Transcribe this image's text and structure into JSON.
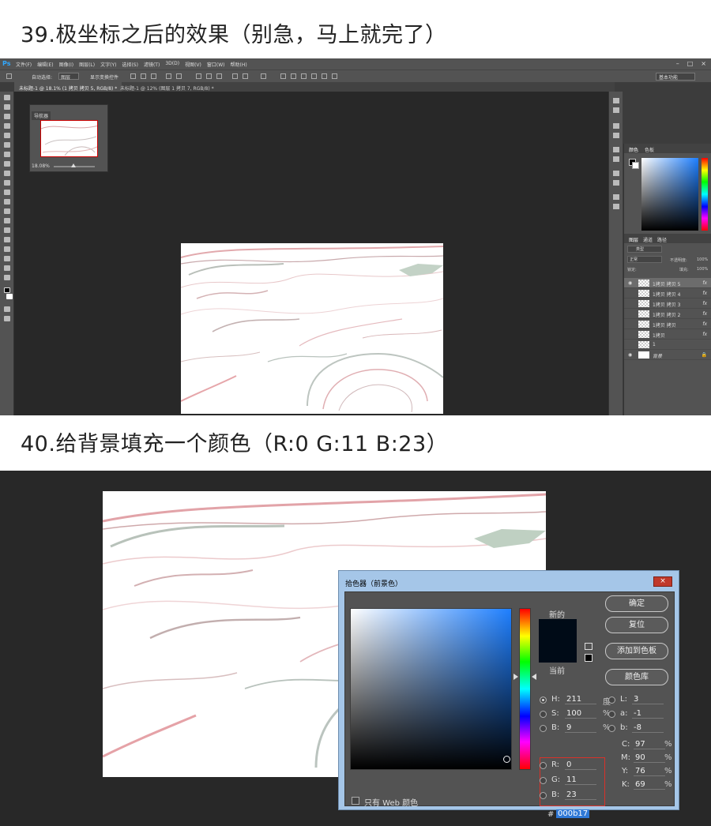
{
  "step39": {
    "title": "39.极坐标之后的效果（别急，马上就完了）"
  },
  "step40": {
    "title": "40.给背景填充一个颜色（R:0  G:11  B:23）"
  },
  "ps": {
    "logo": "Ps",
    "menus": [
      "文件(F)",
      "编辑(E)",
      "图像(I)",
      "图层(L)",
      "文字(Y)",
      "选择(S)",
      "滤镜(T)",
      "3D(D)",
      "视图(V)",
      "窗口(W)",
      "帮助(H)"
    ],
    "options": {
      "auto_select": "自动选择:",
      "auto_select_value": "图层",
      "show_transform": "显示变换控件"
    },
    "workspace": "基本功能",
    "tabs": [
      "未标题-1 @ 18.1% (1 拷贝 拷贝 5, RGB/8) *",
      "未标题-1 @ 12% (图层 1 拷贝 7, RGB/8) *"
    ],
    "navigator": {
      "title": "导航器",
      "zoom": "18.08%"
    },
    "color_panel": {
      "tabs": [
        "颜色",
        "色板"
      ]
    },
    "layers_panel": {
      "tabs": [
        "图层",
        "通道",
        "路径"
      ],
      "filter": "类型",
      "blend": "正常",
      "opacity_label": "不透明度:",
      "opacity": "100%",
      "lock_label": "锁定:",
      "fill_label": "填充:",
      "fill": "100%",
      "layers": [
        {
          "name": "1拷贝 拷贝 5",
          "fx": "fx"
        },
        {
          "name": "1拷贝 拷贝 4",
          "fx": "fx"
        },
        {
          "name": "1拷贝 拷贝 3",
          "fx": "fx"
        },
        {
          "name": "1拷贝 拷贝 2",
          "fx": "fx"
        },
        {
          "name": "1拷贝 拷贝",
          "fx": "fx"
        },
        {
          "name": "1拷贝",
          "fx": "fx"
        },
        {
          "name": "1",
          "fx": ""
        },
        {
          "name": "背景",
          "fx": ""
        }
      ]
    }
  },
  "picker": {
    "title": "拾色器（前景色）",
    "close": "×",
    "new_label": "新的",
    "current_label": "当前",
    "new_color": "#000b17",
    "current_color": "#000b17",
    "buttons": {
      "ok": "确定",
      "reset": "复位",
      "add_swatch": "添加到色板",
      "libraries": "颜色库"
    },
    "hsb": [
      {
        "label": "H:",
        "value": "211",
        "unit": "度"
      },
      {
        "label": "S:",
        "value": "100",
        "unit": "%"
      },
      {
        "label": "B:",
        "value": "9",
        "unit": "%"
      }
    ],
    "rgb": [
      {
        "label": "R:",
        "value": "0"
      },
      {
        "label": "G:",
        "value": "11"
      },
      {
        "label": "B:",
        "value": "23"
      }
    ],
    "lab": [
      {
        "label": "L:",
        "value": "3"
      },
      {
        "label": "a:",
        "value": "-1"
      },
      {
        "label": "b:",
        "value": "-8"
      }
    ],
    "cmyk": [
      {
        "label": "C:",
        "value": "97",
        "unit": "%"
      },
      {
        "label": "M:",
        "value": "90",
        "unit": "%"
      },
      {
        "label": "Y:",
        "value": "76",
        "unit": "%"
      },
      {
        "label": "K:",
        "value": "69",
        "unit": "%"
      }
    ],
    "hex_hash": "#",
    "hex": "000b17",
    "web_only": "只有 Web 颜色"
  }
}
